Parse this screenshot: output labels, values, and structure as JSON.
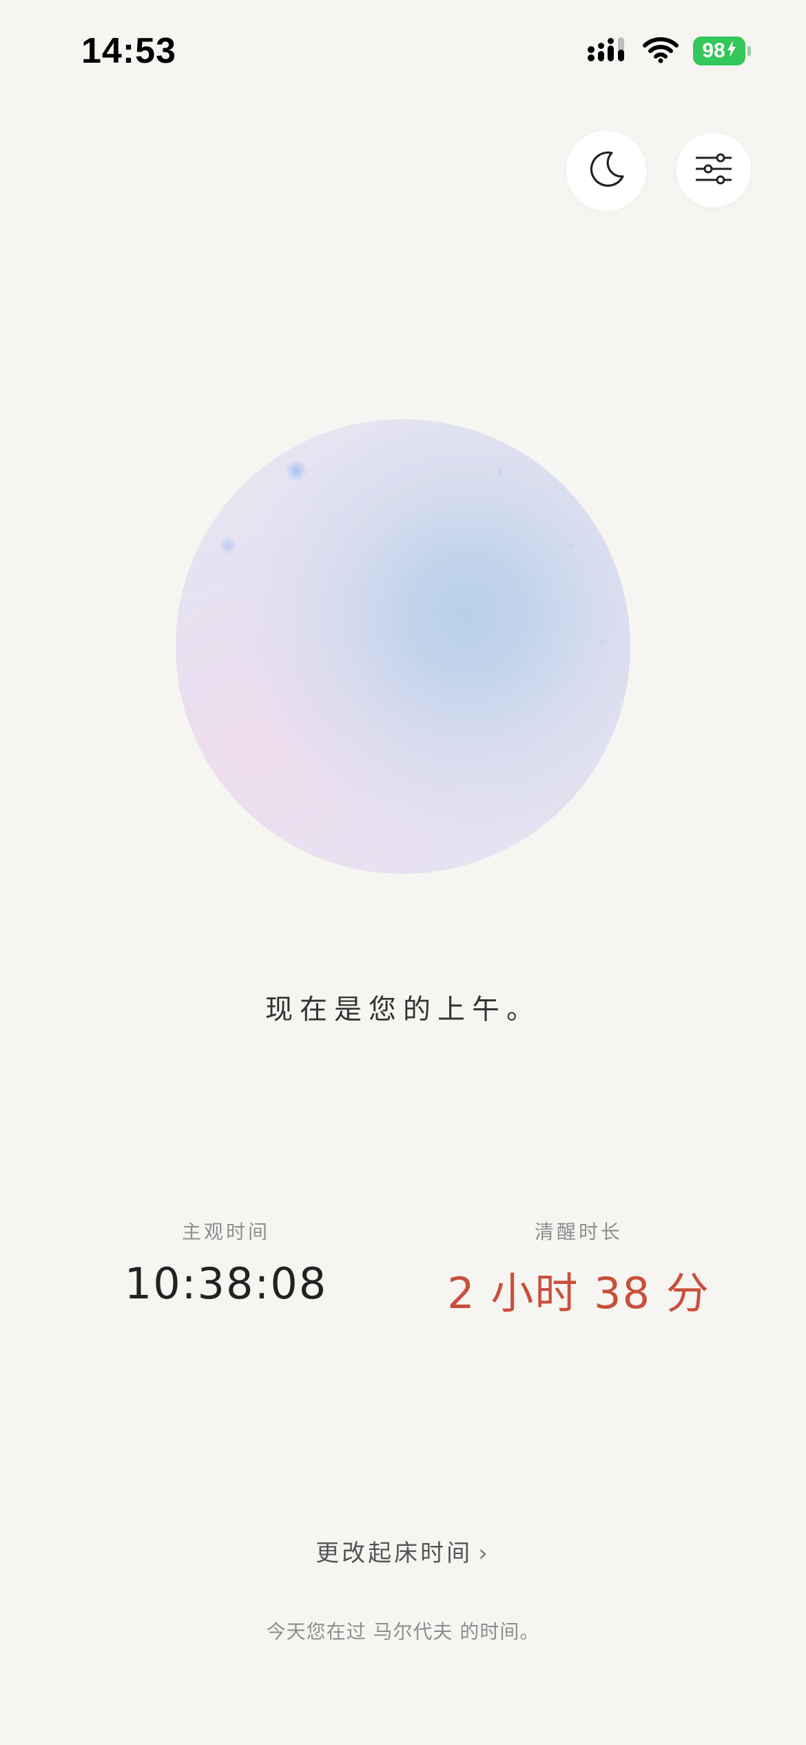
{
  "status_bar": {
    "time": "14:53",
    "battery_level": "98",
    "battery_color": "#34c759"
  },
  "header": {
    "night_mode_icon": "moon-icon",
    "settings_icon": "sliders-icon"
  },
  "main": {
    "period_text": "现在是您的上午。",
    "stats": {
      "subjective_time_label": "主观时间",
      "subjective_time_value": "10:38:08",
      "awake_duration_label": "清醒时长",
      "awake_duration_value": "2 小时 38 分",
      "accent_color": "#c8503c"
    },
    "change_wake_label": "更改起床时间",
    "change_wake_chevron": "›",
    "footer_note": "今天您在过 马尔代夫 的时间。"
  }
}
